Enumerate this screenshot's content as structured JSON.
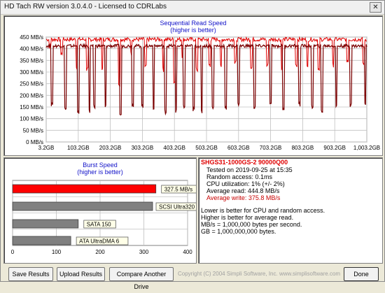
{
  "window": {
    "title": "HD Tach RW version 3.0.4.0 - Licensed to CDRLabs",
    "close_label": "✕"
  },
  "seq_chart": {
    "title": "Sequential Read Speed",
    "subtitle": "(higher is better)"
  },
  "burst_chart": {
    "title": "Burst Speed",
    "subtitle": "(higher is better)"
  },
  "chart_data": [
    {
      "type": "line",
      "title": "Sequential Read Speed",
      "subtitle": "(higher is better)",
      "x_tick_labels": [
        "3.2GB",
        "103.2GB",
        "203.2GB",
        "303.2GB",
        "403.2GB",
        "503.2GB",
        "603.2GB",
        "703.2GB",
        "803.2GB",
        "903.2GB",
        "1,003.2GB"
      ],
      "y_tick_labels": [
        "0 MB/s",
        "50 MB/s",
        "100 MB/s",
        "150 MB/s",
        "200 MB/s",
        "250 MB/s",
        "300 MB/s",
        "350 MB/s",
        "400 MB/s",
        "450 MB/s"
      ],
      "ylim": [
        0,
        450
      ],
      "xlim": [
        3.2,
        1003.2
      ],
      "grid": true,
      "series": [
        {
          "color": "#e00000",
          "base": 440,
          "dips": [
            [
              12,
              400
            ],
            [
              48,
              370
            ],
            [
              95,
              310
            ],
            [
              128,
              300
            ],
            [
              175,
              300
            ],
            [
              228,
              240
            ],
            [
              265,
              370
            ],
            [
              310,
              310
            ],
            [
              365,
              300
            ],
            [
              400,
              250
            ],
            [
              425,
              360
            ],
            [
              470,
              300
            ],
            [
              510,
              320
            ],
            [
              545,
              310
            ],
            [
              590,
              330
            ],
            [
              640,
              310
            ],
            [
              690,
              320
            ],
            [
              735,
              300
            ],
            [
              780,
              320
            ],
            [
              815,
              310
            ],
            [
              850,
              300
            ],
            [
              895,
              320
            ],
            [
              940,
              340
            ],
            [
              990,
              330
            ]
          ]
        },
        {
          "color": "#7a0000",
          "base": 412,
          "dips": [
            [
              18,
              150
            ],
            [
              60,
              130
            ],
            [
              100,
              120
            ],
            [
              135,
              120
            ],
            [
              150,
              140
            ],
            [
              185,
              140
            ],
            [
              232,
              110
            ],
            [
              270,
              150
            ],
            [
              300,
              140
            ],
            [
              335,
              140
            ],
            [
              372,
              120
            ],
            [
              405,
              120
            ],
            [
              430,
              140
            ],
            [
              460,
              130
            ],
            [
              485,
              120
            ],
            [
              520,
              140
            ],
            [
              560,
              135
            ],
            [
              600,
              150
            ],
            [
              650,
              140
            ],
            [
              700,
              150
            ],
            [
              740,
              130
            ],
            [
              790,
              150
            ],
            [
              830,
              140
            ],
            [
              860,
              120
            ],
            [
              905,
              140
            ],
            [
              950,
              150
            ],
            [
              995,
              160
            ]
          ]
        }
      ]
    },
    {
      "type": "bar",
      "title": "Burst Speed",
      "subtitle": "(higher is better)",
      "orientation": "horizontal",
      "xlim": [
        0,
        400
      ],
      "x_tick_labels": [
        "0",
        "100",
        "200",
        "300",
        "400"
      ],
      "grid": true,
      "bars": [
        {
          "label": "327.5 MB/s",
          "value": 327.5,
          "color": "#ff0000"
        },
        {
          "label": "SCSI Ultra320",
          "value": 320,
          "color": "#808080"
        },
        {
          "label": "SATA 150",
          "value": 150,
          "color": "#808080"
        },
        {
          "label": "ATA UltraDMA 6",
          "value": 133,
          "color": "#808080"
        }
      ]
    }
  ],
  "info": {
    "drive_name": "SHGS31-1000GS-2 90000Q00",
    "lines": [
      "Tested on 2019-09-25 at 15:35",
      "Random access: 0.1ms",
      "CPU utilization: 1% (+/- 2%)",
      "Average read: 444.8 MB/s"
    ],
    "avg_write": "Average write: 375.8 MB/s",
    "notes": [
      "Lower is better for CPU and random access.",
      "Higher is better for average read.",
      "MB/s = 1,000,000 bytes per second.",
      "GB = 1,000,000,000 bytes."
    ]
  },
  "buttons": {
    "save": "Save Results",
    "upload": "Upload Results",
    "compare": "Compare Another Drive",
    "done": "Done"
  },
  "footer": "Copyright (C) 2004 Simpli Software, Inc. www.simplisoftware.com"
}
